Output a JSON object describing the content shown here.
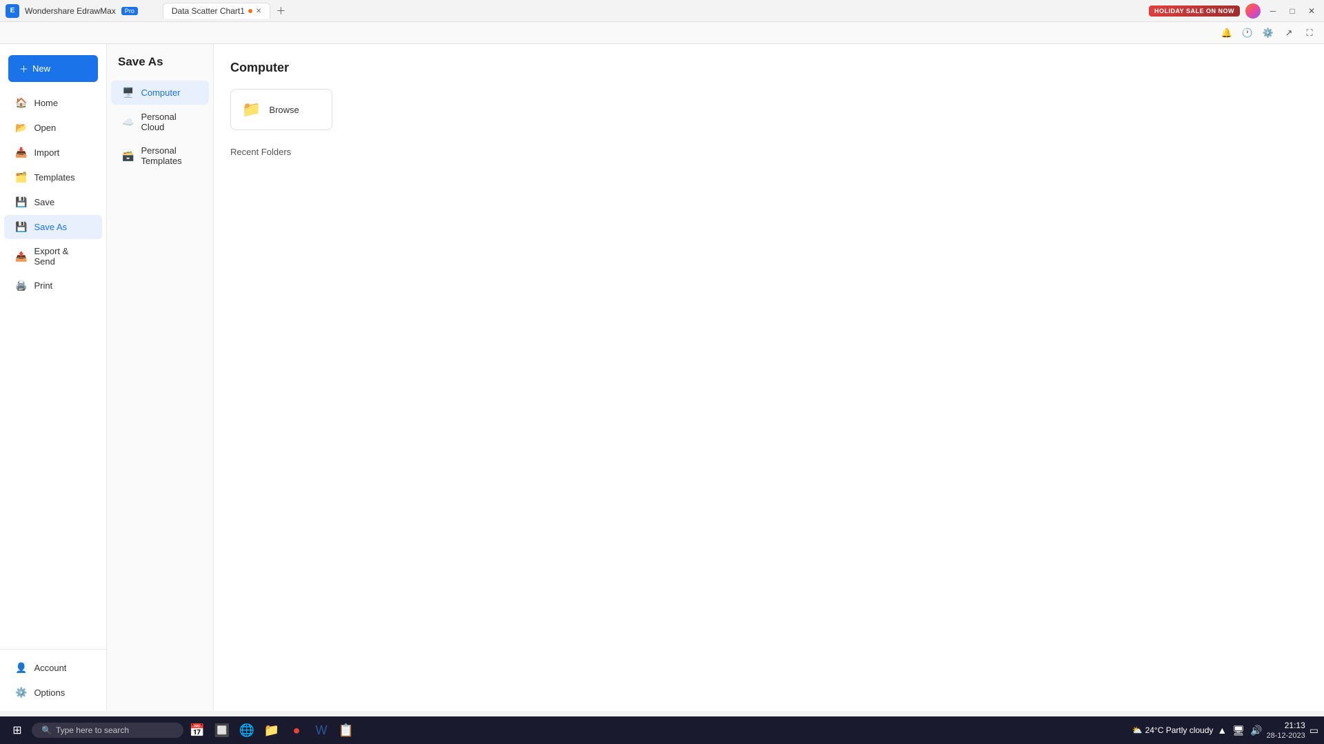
{
  "app": {
    "name": "Wondershare EdrawMax",
    "pro_badge": "Pro",
    "tab_label": "Data Scatter Chart1",
    "holiday_btn": "HOLIDAY SALE ON NOW"
  },
  "new_button": {
    "label": "New"
  },
  "sidebar": {
    "items": [
      {
        "id": "home",
        "label": "Home",
        "icon": "🏠"
      },
      {
        "id": "open",
        "label": "Open",
        "icon": "📂"
      },
      {
        "id": "import",
        "label": "Import",
        "icon": "📥"
      },
      {
        "id": "templates",
        "label": "Templates",
        "icon": "🗂️"
      },
      {
        "id": "save",
        "label": "Save",
        "icon": "💾"
      },
      {
        "id": "save-as",
        "label": "Save As",
        "icon": "💾"
      },
      {
        "id": "export-send",
        "label": "Export & Send",
        "icon": "📤"
      },
      {
        "id": "print",
        "label": "Print",
        "icon": "🖨️"
      }
    ],
    "bottom": [
      {
        "id": "account",
        "label": "Account",
        "icon": "👤"
      },
      {
        "id": "options",
        "label": "Options",
        "icon": "⚙️"
      }
    ]
  },
  "save_as_panel": {
    "title": "Save As",
    "options": [
      {
        "id": "computer",
        "label": "Computer",
        "icon": "🖥️"
      },
      {
        "id": "personal-cloud",
        "label": "Personal Cloud",
        "icon": "☁️"
      },
      {
        "id": "personal-templates",
        "label": "Personal Templates",
        "icon": "🗃️"
      }
    ]
  },
  "content": {
    "title": "Computer",
    "browse_label": "Browse",
    "recent_folders_label": "Recent Folders"
  },
  "taskbar": {
    "search_placeholder": "Type here to search",
    "time": "21:13",
    "date": "28-12-2023",
    "weather": "24°C  Partly cloudy",
    "apps": [
      {
        "icon": "📅",
        "name": "calendar"
      },
      {
        "icon": "🔲",
        "name": "task-view"
      },
      {
        "icon": "🌐",
        "name": "edge"
      },
      {
        "icon": "📁",
        "name": "file-explorer"
      },
      {
        "icon": "🟥",
        "name": "chrome"
      },
      {
        "icon": "📝",
        "name": "word"
      },
      {
        "icon": "📋",
        "name": "app6"
      }
    ]
  }
}
